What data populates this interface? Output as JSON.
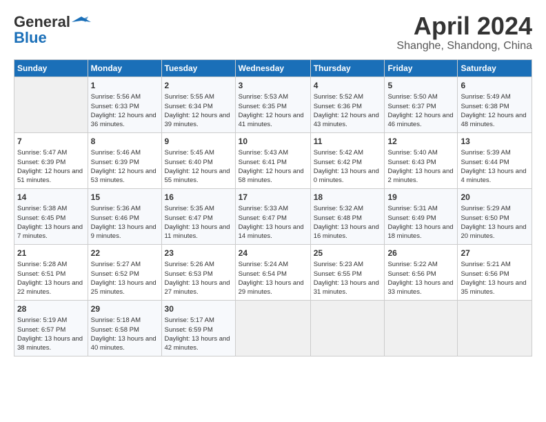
{
  "header": {
    "logo_line1": "General",
    "logo_line2": "Blue",
    "month": "April 2024",
    "location": "Shanghe, Shandong, China"
  },
  "days_of_week": [
    "Sunday",
    "Monday",
    "Tuesday",
    "Wednesday",
    "Thursday",
    "Friday",
    "Saturday"
  ],
  "weeks": [
    [
      {
        "day": "",
        "sunrise": "",
        "sunset": "",
        "daylight": ""
      },
      {
        "day": "1",
        "sunrise": "Sunrise: 5:56 AM",
        "sunset": "Sunset: 6:33 PM",
        "daylight": "Daylight: 12 hours and 36 minutes."
      },
      {
        "day": "2",
        "sunrise": "Sunrise: 5:55 AM",
        "sunset": "Sunset: 6:34 PM",
        "daylight": "Daylight: 12 hours and 39 minutes."
      },
      {
        "day": "3",
        "sunrise": "Sunrise: 5:53 AM",
        "sunset": "Sunset: 6:35 PM",
        "daylight": "Daylight: 12 hours and 41 minutes."
      },
      {
        "day": "4",
        "sunrise": "Sunrise: 5:52 AM",
        "sunset": "Sunset: 6:36 PM",
        "daylight": "Daylight: 12 hours and 43 minutes."
      },
      {
        "day": "5",
        "sunrise": "Sunrise: 5:50 AM",
        "sunset": "Sunset: 6:37 PM",
        "daylight": "Daylight: 12 hours and 46 minutes."
      },
      {
        "day": "6",
        "sunrise": "Sunrise: 5:49 AM",
        "sunset": "Sunset: 6:38 PM",
        "daylight": "Daylight: 12 hours and 48 minutes."
      }
    ],
    [
      {
        "day": "7",
        "sunrise": "Sunrise: 5:47 AM",
        "sunset": "Sunset: 6:39 PM",
        "daylight": "Daylight: 12 hours and 51 minutes."
      },
      {
        "day": "8",
        "sunrise": "Sunrise: 5:46 AM",
        "sunset": "Sunset: 6:39 PM",
        "daylight": "Daylight: 12 hours and 53 minutes."
      },
      {
        "day": "9",
        "sunrise": "Sunrise: 5:45 AM",
        "sunset": "Sunset: 6:40 PM",
        "daylight": "Daylight: 12 hours and 55 minutes."
      },
      {
        "day": "10",
        "sunrise": "Sunrise: 5:43 AM",
        "sunset": "Sunset: 6:41 PM",
        "daylight": "Daylight: 12 hours and 58 minutes."
      },
      {
        "day": "11",
        "sunrise": "Sunrise: 5:42 AM",
        "sunset": "Sunset: 6:42 PM",
        "daylight": "Daylight: 13 hours and 0 minutes."
      },
      {
        "day": "12",
        "sunrise": "Sunrise: 5:40 AM",
        "sunset": "Sunset: 6:43 PM",
        "daylight": "Daylight: 13 hours and 2 minutes."
      },
      {
        "day": "13",
        "sunrise": "Sunrise: 5:39 AM",
        "sunset": "Sunset: 6:44 PM",
        "daylight": "Daylight: 13 hours and 4 minutes."
      }
    ],
    [
      {
        "day": "14",
        "sunrise": "Sunrise: 5:38 AM",
        "sunset": "Sunset: 6:45 PM",
        "daylight": "Daylight: 13 hours and 7 minutes."
      },
      {
        "day": "15",
        "sunrise": "Sunrise: 5:36 AM",
        "sunset": "Sunset: 6:46 PM",
        "daylight": "Daylight: 13 hours and 9 minutes."
      },
      {
        "day": "16",
        "sunrise": "Sunrise: 5:35 AM",
        "sunset": "Sunset: 6:47 PM",
        "daylight": "Daylight: 13 hours and 11 minutes."
      },
      {
        "day": "17",
        "sunrise": "Sunrise: 5:33 AM",
        "sunset": "Sunset: 6:47 PM",
        "daylight": "Daylight: 13 hours and 14 minutes."
      },
      {
        "day": "18",
        "sunrise": "Sunrise: 5:32 AM",
        "sunset": "Sunset: 6:48 PM",
        "daylight": "Daylight: 13 hours and 16 minutes."
      },
      {
        "day": "19",
        "sunrise": "Sunrise: 5:31 AM",
        "sunset": "Sunset: 6:49 PM",
        "daylight": "Daylight: 13 hours and 18 minutes."
      },
      {
        "day": "20",
        "sunrise": "Sunrise: 5:29 AM",
        "sunset": "Sunset: 6:50 PM",
        "daylight": "Daylight: 13 hours and 20 minutes."
      }
    ],
    [
      {
        "day": "21",
        "sunrise": "Sunrise: 5:28 AM",
        "sunset": "Sunset: 6:51 PM",
        "daylight": "Daylight: 13 hours and 22 minutes."
      },
      {
        "day": "22",
        "sunrise": "Sunrise: 5:27 AM",
        "sunset": "Sunset: 6:52 PM",
        "daylight": "Daylight: 13 hours and 25 minutes."
      },
      {
        "day": "23",
        "sunrise": "Sunrise: 5:26 AM",
        "sunset": "Sunset: 6:53 PM",
        "daylight": "Daylight: 13 hours and 27 minutes."
      },
      {
        "day": "24",
        "sunrise": "Sunrise: 5:24 AM",
        "sunset": "Sunset: 6:54 PM",
        "daylight": "Daylight: 13 hours and 29 minutes."
      },
      {
        "day": "25",
        "sunrise": "Sunrise: 5:23 AM",
        "sunset": "Sunset: 6:55 PM",
        "daylight": "Daylight: 13 hours and 31 minutes."
      },
      {
        "day": "26",
        "sunrise": "Sunrise: 5:22 AM",
        "sunset": "Sunset: 6:56 PM",
        "daylight": "Daylight: 13 hours and 33 minutes."
      },
      {
        "day": "27",
        "sunrise": "Sunrise: 5:21 AM",
        "sunset": "Sunset: 6:56 PM",
        "daylight": "Daylight: 13 hours and 35 minutes."
      }
    ],
    [
      {
        "day": "28",
        "sunrise": "Sunrise: 5:19 AM",
        "sunset": "Sunset: 6:57 PM",
        "daylight": "Daylight: 13 hours and 38 minutes."
      },
      {
        "day": "29",
        "sunrise": "Sunrise: 5:18 AM",
        "sunset": "Sunset: 6:58 PM",
        "daylight": "Daylight: 13 hours and 40 minutes."
      },
      {
        "day": "30",
        "sunrise": "Sunrise: 5:17 AM",
        "sunset": "Sunset: 6:59 PM",
        "daylight": "Daylight: 13 hours and 42 minutes."
      },
      {
        "day": "",
        "sunrise": "",
        "sunset": "",
        "daylight": ""
      },
      {
        "day": "",
        "sunrise": "",
        "sunset": "",
        "daylight": ""
      },
      {
        "day": "",
        "sunrise": "",
        "sunset": "",
        "daylight": ""
      },
      {
        "day": "",
        "sunrise": "",
        "sunset": "",
        "daylight": ""
      }
    ]
  ]
}
